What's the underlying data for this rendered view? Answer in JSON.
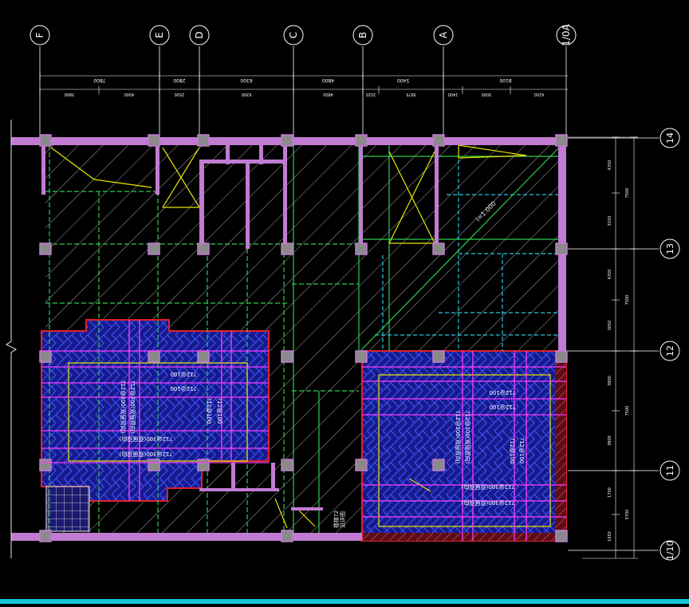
{
  "grid_axes_top": [
    "F",
    "E",
    "D",
    "C",
    "B",
    "A",
    "1/0A"
  ],
  "grid_axes_right": [
    "14",
    "13",
    "12",
    "11",
    "1/10"
  ],
  "top_overall_dims": [
    "7800",
    "2800",
    "6300",
    "4800",
    "5400",
    "8100"
  ],
  "top_detail_dims": [
    "3900",
    "4000",
    "2500",
    "6300",
    "4800",
    "1025",
    "3975",
    "1400",
    "3000",
    "4200"
  ],
  "right_overall_dims": [
    "7500",
    "7500",
    "7500",
    "5700"
  ],
  "right_detail_dims": [
    "4350",
    "3150",
    "4350",
    "3050",
    "3800",
    "3800",
    "1700",
    "1050"
  ],
  "slope_label": "i=1.000",
  "left_slab_notes": [
    "?12@100",
    "?12@100",
    "?12@300(双层双向)",
    "?12@300(双层双向)",
    "?12@100",
    "?12@100",
    "?12@300(双层双向)",
    "?12@300(双层双向)"
  ],
  "right_slab_notes": [
    "?12@100",
    "?12@100",
    "?12@300(双层双向)",
    "?12@300(双层双向)",
    "?12@100",
    "?12@100",
    "?12@300(双层双向)",
    "?12@300(双层双向)"
  ],
  "stair_note_a": "楼梯?2",
  "stair_note_b": "见详图",
  "colors": {
    "background": "#000000",
    "axis": "#ffffff",
    "dim": "#ffffff",
    "wall": "#c27bd2",
    "column": "#8a8a8a",
    "hatch": "#d8d8d8",
    "beam_green": "#2ccc4e",
    "beam_cyan": "#27c7e0",
    "slab_fill": "#181a8c",
    "slab_border": "#e0212c",
    "rebar": "#ff3cff",
    "yellow": "#e8e800",
    "status_bar": "#16c7d6"
  }
}
